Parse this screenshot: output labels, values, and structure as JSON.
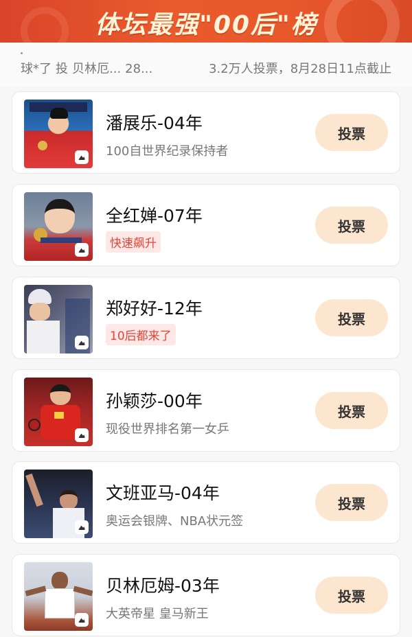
{
  "banner": {
    "title": "体坛最强\"00后\"榜"
  },
  "info": {
    "left_items": [
      "球*了",
      "投",
      "贝林厄...",
      "28..."
    ],
    "right_text": "3.2万人投票，8月28日11点截止"
  },
  "vote_label": "投票",
  "candidates": [
    {
      "name": "潘展乐-04年",
      "subtitle": "100自世界纪录保持者",
      "subtitle_style": "plain",
      "photo": "swimmer-podium-photo"
    },
    {
      "name": "全红婵-07年",
      "subtitle": "快速飙升",
      "subtitle_style": "tag",
      "photo": "diver-medal-photo"
    },
    {
      "name": "郑好好-12年",
      "subtitle": "10后都来了",
      "subtitle_style": "tag",
      "photo": "skateboarder-helmet-photo"
    },
    {
      "name": "孙颖莎-00年",
      "subtitle": "现役世界排名第一女乒",
      "subtitle_style": "plain",
      "photo": "table-tennis-player-photo"
    },
    {
      "name": "文班亚马-04年",
      "subtitle": "奥运会银牌、NBA状元签",
      "subtitle_style": "plain",
      "photo": "basketball-player-photo"
    },
    {
      "name": "贝林厄姆-03年",
      "subtitle": "大英帝星 皇马新王",
      "subtitle_style": "plain",
      "photo": "football-player-photo"
    }
  ]
}
